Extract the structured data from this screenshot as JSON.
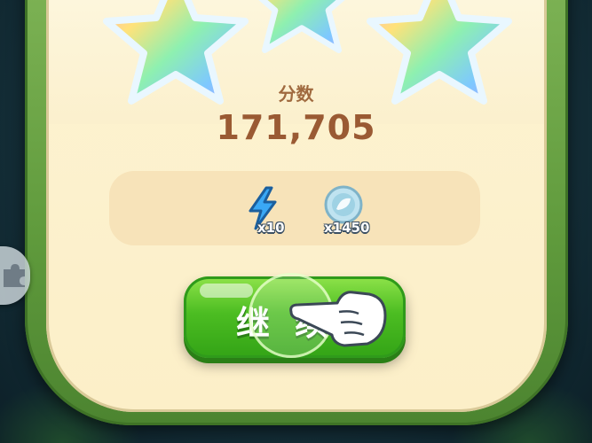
{
  "result": {
    "score_label": "分数",
    "score_value": "171,705",
    "stars_earned": 3
  },
  "rewards": [
    {
      "icon": "lightning-bolt-icon",
      "count": "x10"
    },
    {
      "icon": "leaf-coin-icon",
      "count": "x1450"
    }
  ],
  "continue_button": {
    "label": "继续"
  },
  "colors": {
    "panel_bg": "#fcefc8",
    "frame_green": "#5f9a3c",
    "score_text": "#9a5a33",
    "button_green": "#4cbd22"
  }
}
